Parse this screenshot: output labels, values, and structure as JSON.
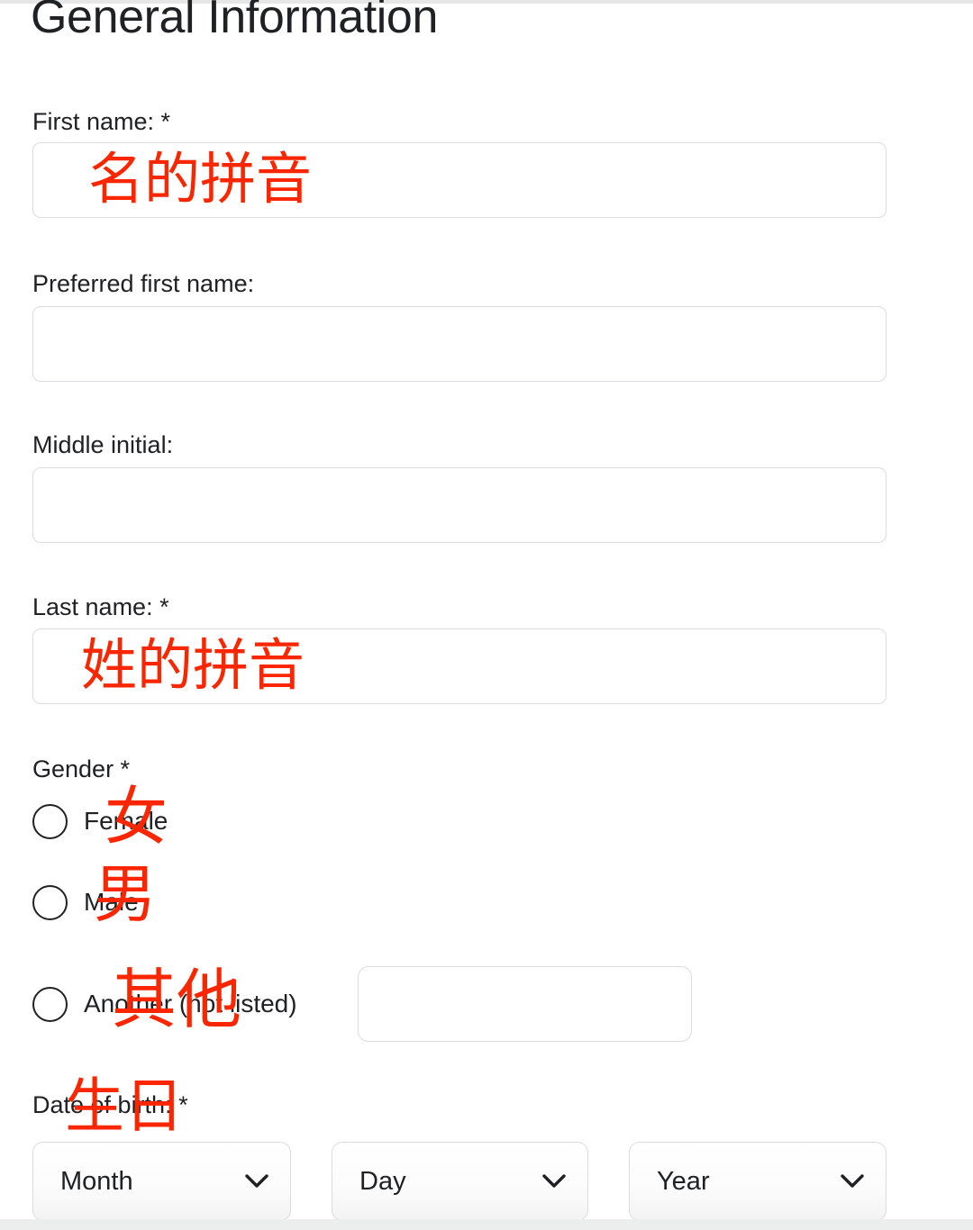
{
  "page": {
    "title": "General Information",
    "accent_red": "#fa2600",
    "text_color": "#202124",
    "input_border": "#dadce0",
    "required_marker": "*"
  },
  "fields": {
    "first_name": {
      "label": "First name: *",
      "value": "",
      "annotation": "名的拼音"
    },
    "preferred_first_name": {
      "label": "Preferred first name:",
      "value": ""
    },
    "middle_initial": {
      "label": "Middle initial:",
      "value": ""
    },
    "last_name": {
      "label": "Last name: *",
      "value": "",
      "annotation": "姓的拼音"
    }
  },
  "gender": {
    "label": "Gender *",
    "options": [
      {
        "label": "Female",
        "annotation": "女",
        "selected": false
      },
      {
        "label": "Male",
        "annotation": "男",
        "selected": false
      },
      {
        "label": "Another (not listed)",
        "annotation": "其他",
        "selected": false
      }
    ],
    "other_input_value": ""
  },
  "date_of_birth": {
    "label": "Date of birth: *",
    "annotation": "生日",
    "selects": [
      {
        "name": "month",
        "value": "Month"
      },
      {
        "name": "day",
        "value": "Day"
      },
      {
        "name": "year",
        "value": "Year"
      }
    ],
    "chevron_icon": "chevron-down-icon"
  }
}
